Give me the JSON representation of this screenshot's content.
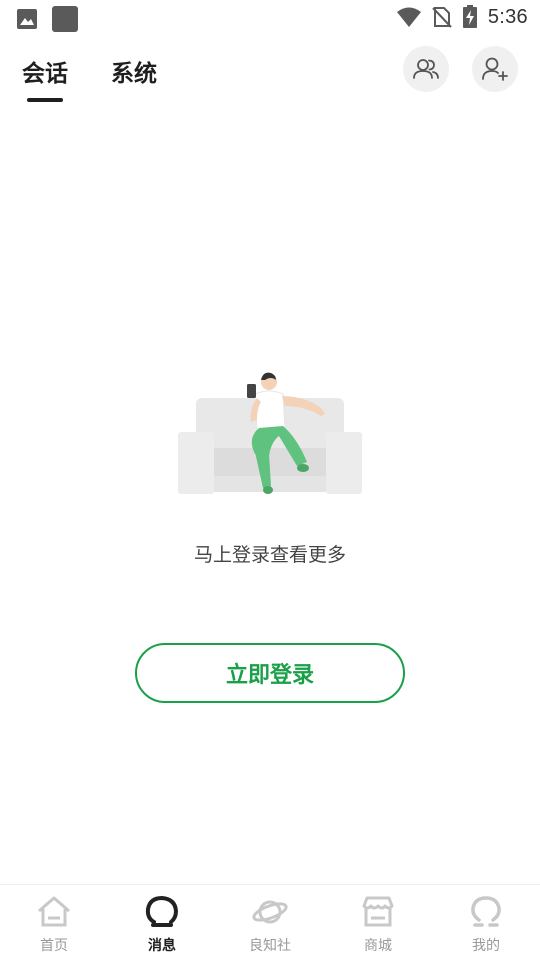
{
  "status_bar": {
    "time": "5:36",
    "icons": [
      "image-icon",
      "app-square-icon",
      "wifi-icon",
      "no-sim-icon",
      "battery-charging-icon"
    ]
  },
  "header": {
    "tabs": [
      {
        "label": "会话",
        "active": true
      },
      {
        "label": "系统",
        "active": false
      }
    ],
    "actions": [
      {
        "icon": "group-icon"
      },
      {
        "icon": "add-friend-icon"
      }
    ]
  },
  "empty_state": {
    "illustration": "person-on-sofa-illustration",
    "message": "马上登录查看更多",
    "button_label": "立即登录"
  },
  "bottom_nav": {
    "items": [
      {
        "label": "首页",
        "icon": "home-icon",
        "active": false
      },
      {
        "label": "消息",
        "icon": "message-icon",
        "active": true
      },
      {
        "label": "良知社",
        "icon": "planet-icon",
        "active": false
      },
      {
        "label": "商城",
        "icon": "store-icon",
        "active": false
      },
      {
        "label": "我的",
        "icon": "profile-icon",
        "active": false
      }
    ]
  },
  "colors": {
    "accent_green": "#1aa048",
    "text_dark": "#1f1f1f",
    "nav_inactive": "#999999",
    "header_button_bg": "#f0f0f0"
  }
}
